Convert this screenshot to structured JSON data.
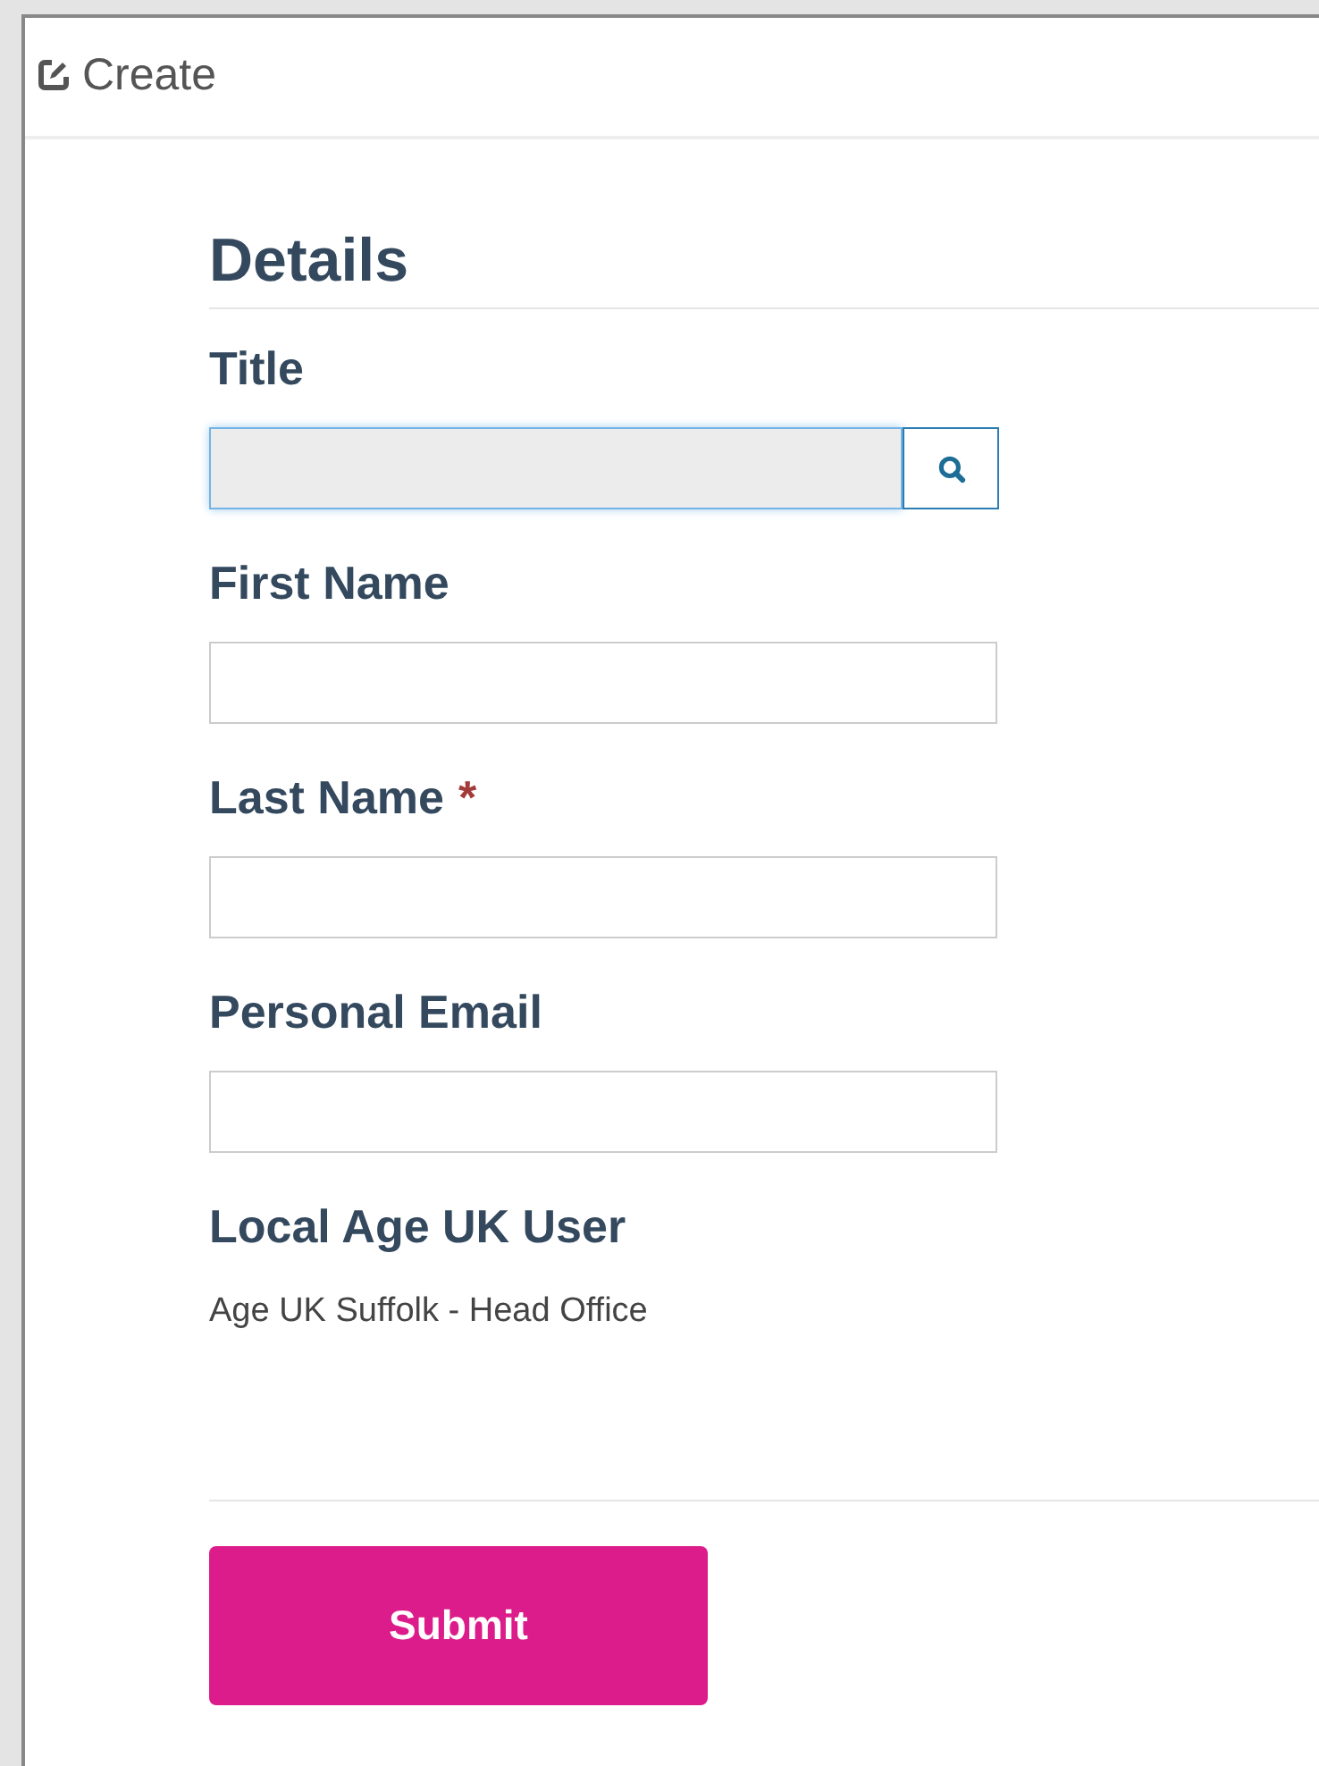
{
  "panel": {
    "title": "Create"
  },
  "section": {
    "heading": "Details"
  },
  "fields": [
    {
      "kind": "lookup",
      "label": "Title",
      "focused": true
    },
    {
      "kind": "text",
      "label": "First Name",
      "focused": false
    },
    {
      "kind": "text",
      "label": "Last Name",
      "marker": "*",
      "focused": false
    },
    {
      "kind": "text",
      "label": "Personal Email",
      "focused": false
    },
    {
      "kind": "static",
      "label": "Local Age UK User",
      "value": "Age UK Suffolk - Head Office"
    }
  ],
  "buttons": [
    {
      "label": "Submit"
    }
  ]
}
